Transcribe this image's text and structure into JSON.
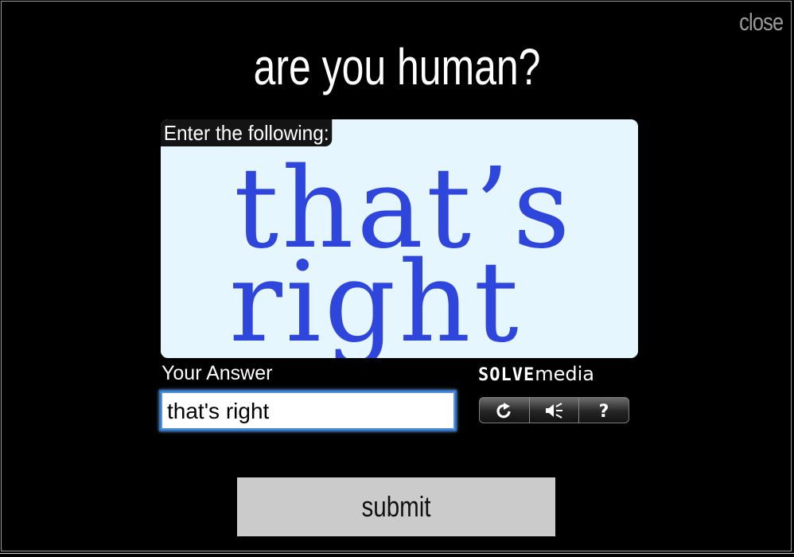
{
  "dialog": {
    "close_label": "close",
    "title": "are you human?"
  },
  "captcha": {
    "instruction": "Enter the following:",
    "challenge_line1": "that’s",
    "challenge_line2": "right",
    "text_color": "#2f46dc",
    "background_color": "#e6f6ff"
  },
  "answer": {
    "label": "Your Answer",
    "value": "that's right"
  },
  "brand": {
    "solve": "SOLVE",
    "media": "media"
  },
  "tools": {
    "icons": [
      "refresh-icon",
      "audio-icon",
      "help-icon"
    ]
  },
  "submit": {
    "label": "submit"
  }
}
